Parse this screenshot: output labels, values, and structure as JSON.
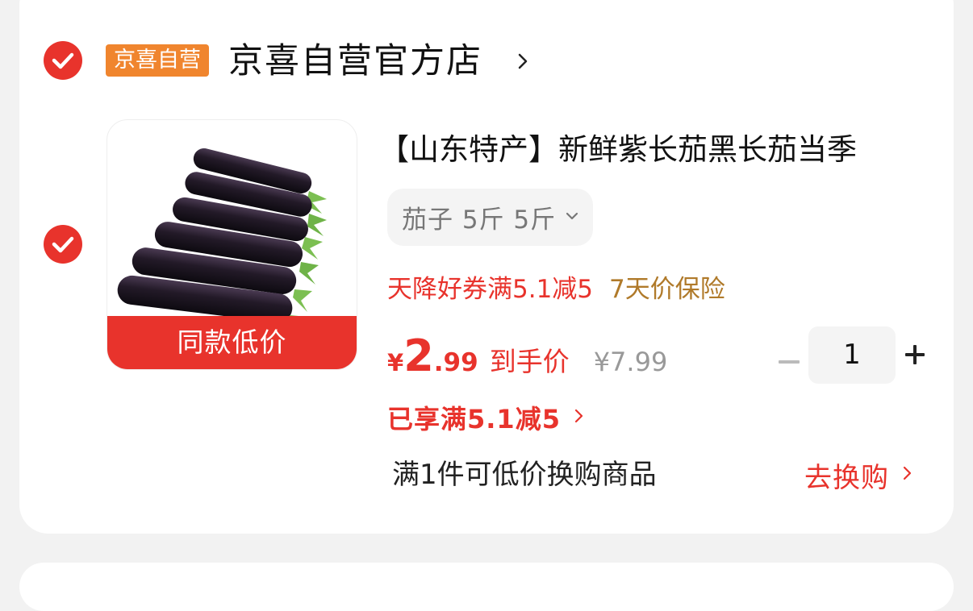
{
  "store": {
    "badge": "京喜自营",
    "name": "京喜自营官方店"
  },
  "item": {
    "thumb_label": "同款低价",
    "title": "【山东特产】新鲜紫长茄黑长茄当季",
    "spec": "茄子 5斤 5斤",
    "promo_coupon": "天降好券满5.1减5",
    "promo_insurance": "7天价保险",
    "price_symbol": "¥",
    "price_integer": "2",
    "price_decimal": ".99",
    "price_label": "到手价",
    "original_price": "¥7.99",
    "quantity": "1",
    "enjoyed_discount": "已享满5.1减5",
    "exchange_text": "满1件可低价换购商品",
    "exchange_link": "去换购"
  },
  "colors": {
    "accent": "#e8332c",
    "badge": "#f0852e",
    "insurance": "#b07a2a"
  },
  "icons": {
    "check": "check-circle-icon",
    "chevron": "chevron-right-icon",
    "spec_dropdown": "chevron-down-icon",
    "minus": "minus-icon",
    "plus": "plus-icon"
  }
}
